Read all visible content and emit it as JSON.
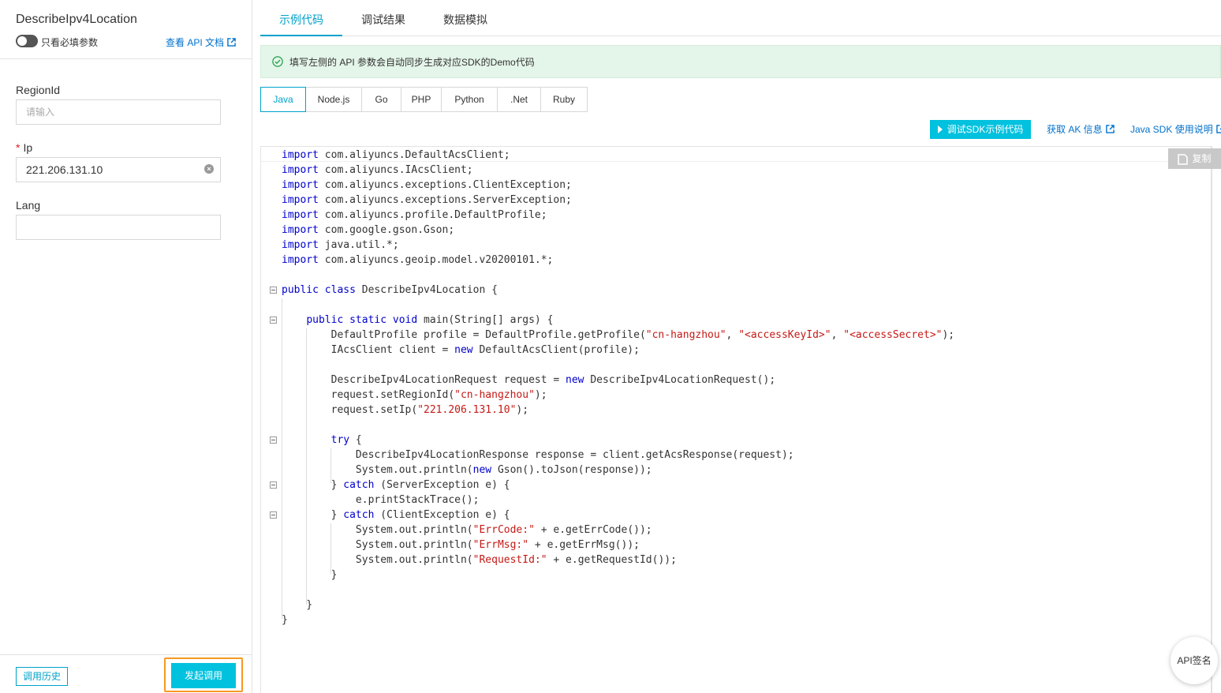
{
  "left": {
    "api_title": "DescribeIpv4Location",
    "toggle_label": "只看必填参数",
    "doc_link": "查看 API 文档",
    "fields": {
      "region": {
        "label": "RegionId",
        "placeholder": "请输入",
        "value": ""
      },
      "ip": {
        "label": "Ip",
        "required_mark": "*",
        "value": "221.206.131.10"
      },
      "lang": {
        "label": "Lang",
        "value": ""
      }
    },
    "history_button": "调用历史",
    "invoke_button": "发起调用"
  },
  "tabs": [
    "示例代码",
    "调试结果",
    "数据模拟"
  ],
  "notice": "填写左侧的 API 参数会自动同步生成对应SDK的Demo代码",
  "lang_tabs": [
    "Java",
    "Node.js",
    "Go",
    "PHP",
    "Python",
    ".Net",
    "Ruby"
  ],
  "toolbar": {
    "debug_sdk": "调试SDK示例代码",
    "get_ak": "获取 AK 信息",
    "java_sdk": "Java SDK 使用说明",
    "copy": "复制"
  },
  "code": [
    [
      [
        "kw",
        "import"
      ],
      [
        "t",
        " com.aliyuncs.DefaultAcsClient;"
      ]
    ],
    [
      [
        "kw",
        "import"
      ],
      [
        "t",
        " com.aliyuncs.IAcsClient;"
      ]
    ],
    [
      [
        "kw",
        "import"
      ],
      [
        "t",
        " com.aliyuncs.exceptions.ClientException;"
      ]
    ],
    [
      [
        "kw",
        "import"
      ],
      [
        "t",
        " com.aliyuncs.exceptions.ServerException;"
      ]
    ],
    [
      [
        "kw",
        "import"
      ],
      [
        "t",
        " com.aliyuncs.profile.DefaultProfile;"
      ]
    ],
    [
      [
        "kw",
        "import"
      ],
      [
        "t",
        " com.google.gson.Gson;"
      ]
    ],
    [
      [
        "kw",
        "import"
      ],
      [
        "t",
        " java.util.*;"
      ]
    ],
    [
      [
        "kw",
        "import"
      ],
      [
        "t",
        " com.aliyuncs.geoip.model.v20200101.*;"
      ]
    ],
    [],
    [
      [
        "kw",
        "public"
      ],
      [
        "t",
        " "
      ],
      [
        "kw",
        "class"
      ],
      [
        "t",
        " DescribeIpv4Location {"
      ]
    ],
    [],
    [
      [
        "t",
        "    "
      ],
      [
        "kw",
        "public"
      ],
      [
        "t",
        " "
      ],
      [
        "kw",
        "static"
      ],
      [
        "t",
        " "
      ],
      [
        "kw",
        "void"
      ],
      [
        "t",
        " main(String[] args) {"
      ]
    ],
    [
      [
        "t",
        "        DefaultProfile profile = DefaultProfile.getProfile("
      ],
      [
        "str",
        "\"cn-hangzhou\""
      ],
      [
        "t",
        ", "
      ],
      [
        "str",
        "\"<accessKeyId>\""
      ],
      [
        "t",
        ", "
      ],
      [
        "str",
        "\"<accessSecret>\""
      ],
      [
        "t",
        ");"
      ]
    ],
    [
      [
        "t",
        "        IAcsClient client = "
      ],
      [
        "kw",
        "new"
      ],
      [
        "t",
        " DefaultAcsClient(profile);"
      ]
    ],
    [],
    [
      [
        "t",
        "        DescribeIpv4LocationRequest request = "
      ],
      [
        "kw",
        "new"
      ],
      [
        "t",
        " DescribeIpv4LocationRequest();"
      ]
    ],
    [
      [
        "t",
        "        request.setRegionId("
      ],
      [
        "str",
        "\"cn-hangzhou\""
      ],
      [
        "t",
        ");"
      ]
    ],
    [
      [
        "t",
        "        request.setIp("
      ],
      [
        "str",
        "\"221.206.131.10\""
      ],
      [
        "t",
        ");"
      ]
    ],
    [],
    [
      [
        "t",
        "        "
      ],
      [
        "kw",
        "try"
      ],
      [
        "t",
        " {"
      ]
    ],
    [
      [
        "t",
        "            DescribeIpv4LocationResponse response = client.getAcsResponse(request);"
      ]
    ],
    [
      [
        "t",
        "            System.out.println("
      ],
      [
        "kw",
        "new"
      ],
      [
        "t",
        " Gson().toJson(response));"
      ]
    ],
    [
      [
        "t",
        "        } "
      ],
      [
        "kw",
        "catch"
      ],
      [
        "t",
        " (ServerException e) {"
      ]
    ],
    [
      [
        "t",
        "            e.printStackTrace();"
      ]
    ],
    [
      [
        "t",
        "        } "
      ],
      [
        "kw",
        "catch"
      ],
      [
        "t",
        " (ClientException e) {"
      ]
    ],
    [
      [
        "t",
        "            System.out.println("
      ],
      [
        "str",
        "\"ErrCode:\""
      ],
      [
        "t",
        " + e.getErrCode());"
      ]
    ],
    [
      [
        "t",
        "            System.out.println("
      ],
      [
        "str",
        "\"ErrMsg:\""
      ],
      [
        "t",
        " + e.getErrMsg());"
      ]
    ],
    [
      [
        "t",
        "            System.out.println("
      ],
      [
        "str",
        "\"RequestId:\""
      ],
      [
        "t",
        " + e.getRequestId());"
      ]
    ],
    [
      [
        "t",
        "        }"
      ]
    ],
    [],
    [
      [
        "t",
        "    }"
      ]
    ],
    [
      [
        "t",
        "}"
      ]
    ]
  ],
  "api_signature": "API签名"
}
